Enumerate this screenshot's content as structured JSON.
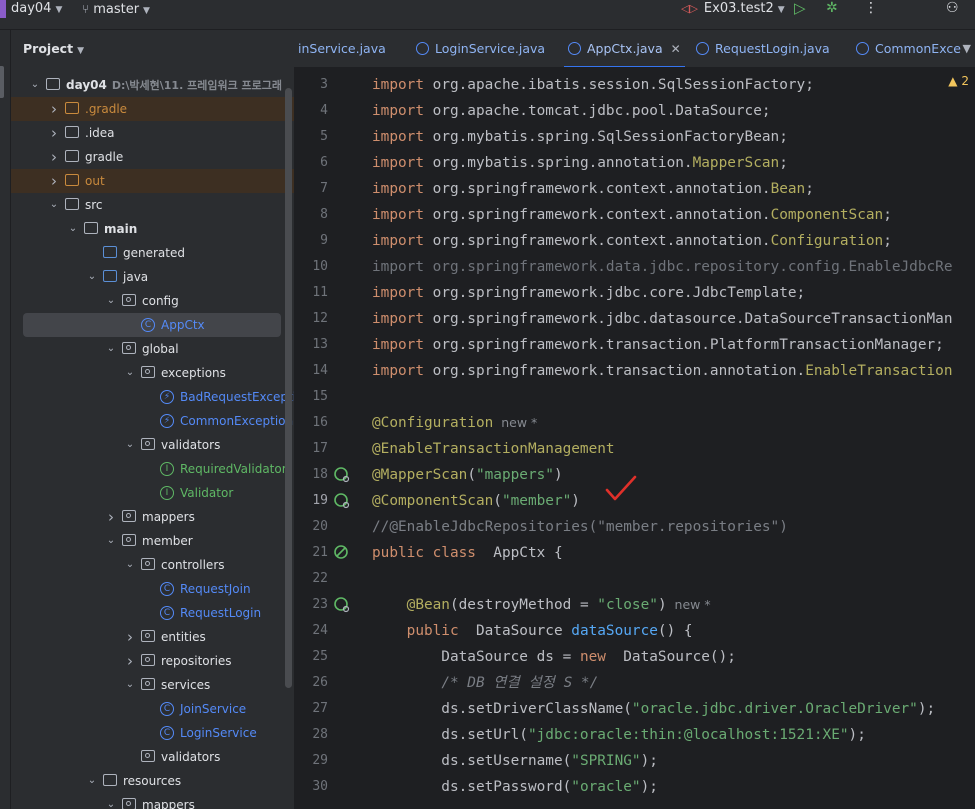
{
  "titlebar": {
    "project": "day04",
    "branch": "master",
    "run_config": "Ex03.test2"
  },
  "project_panel": {
    "title": "Project",
    "tree": [
      {
        "label": "day04",
        "path": "D:\\박세현\\11. 프레임워크 프로그래",
        "depth": 0,
        "kind": "module",
        "expanded": true
      },
      {
        "label": ".gradle",
        "depth": 1,
        "kind": "folder",
        "excluded": true,
        "expanded": false
      },
      {
        "label": ".idea",
        "depth": 1,
        "kind": "folder",
        "expanded": false
      },
      {
        "label": "gradle",
        "depth": 1,
        "kind": "folder",
        "expanded": false
      },
      {
        "label": "out",
        "depth": 1,
        "kind": "folder",
        "excluded": true,
        "expanded": false
      },
      {
        "label": "src",
        "depth": 1,
        "kind": "folder",
        "expanded": true
      },
      {
        "label": "main",
        "depth": 2,
        "kind": "module",
        "expanded": true
      },
      {
        "label": "generated",
        "depth": 3,
        "kind": "srcfolder",
        "leaf": true
      },
      {
        "label": "java",
        "depth": 3,
        "kind": "srcfolder",
        "expanded": true
      },
      {
        "label": "config",
        "depth": 4,
        "kind": "package",
        "expanded": true
      },
      {
        "label": "AppCtx",
        "depth": 5,
        "kind": "class",
        "selected": true
      },
      {
        "label": "global",
        "depth": 4,
        "kind": "package",
        "expanded": true
      },
      {
        "label": "exceptions",
        "depth": 5,
        "kind": "package",
        "expanded": true
      },
      {
        "label": "BadRequestException",
        "depth": 6,
        "kind": "exception"
      },
      {
        "label": "CommonException",
        "depth": 6,
        "kind": "exception"
      },
      {
        "label": "validators",
        "depth": 5,
        "kind": "package",
        "expanded": true
      },
      {
        "label": "RequiredValidator",
        "depth": 6,
        "kind": "interface"
      },
      {
        "label": "Validator",
        "depth": 6,
        "kind": "interface"
      },
      {
        "label": "mappers",
        "depth": 4,
        "kind": "package",
        "expanded": false
      },
      {
        "label": "member",
        "depth": 4,
        "kind": "package",
        "expanded": true
      },
      {
        "label": "controllers",
        "depth": 5,
        "kind": "package",
        "expanded": true
      },
      {
        "label": "RequestJoin",
        "depth": 6,
        "kind": "class"
      },
      {
        "label": "RequestLogin",
        "depth": 6,
        "kind": "class"
      },
      {
        "label": "entities",
        "depth": 5,
        "kind": "package",
        "expanded": false
      },
      {
        "label": "repositories",
        "depth": 5,
        "kind": "package",
        "expanded": false
      },
      {
        "label": "services",
        "depth": 5,
        "kind": "package",
        "expanded": true
      },
      {
        "label": "JoinService",
        "depth": 6,
        "kind": "class"
      },
      {
        "label": "LoginService",
        "depth": 6,
        "kind": "class"
      },
      {
        "label": "validators",
        "depth": 5,
        "kind": "package",
        "leaf": true
      },
      {
        "label": "resources",
        "depth": 3,
        "kind": "resfolder",
        "expanded": true
      },
      {
        "label": "mappers",
        "depth": 4,
        "kind": "package",
        "expanded": true
      }
    ]
  },
  "tabs": [
    {
      "label": "inService.java",
      "active": false
    },
    {
      "label": "LoginService.java",
      "active": false
    },
    {
      "label": "AppCtx.java",
      "active": true
    },
    {
      "label": "RequestLogin.java",
      "active": false
    },
    {
      "label": "CommonExce",
      "active": false
    }
  ],
  "editor": {
    "warnings": "2",
    "hint_new": "new *",
    "lines": [
      {
        "n": "3",
        "parts": [
          [
            "kw",
            "import"
          ],
          [
            "",
            "org.apache.ibatis.session.SqlSessionFactory;"
          ]
        ]
      },
      {
        "n": "4",
        "parts": [
          [
            "kw",
            "import"
          ],
          [
            "",
            "org.apache.tomcat.jdbc.pool.DataSource;"
          ]
        ]
      },
      {
        "n": "5",
        "parts": [
          [
            "kw",
            "import"
          ],
          [
            "",
            "org.mybatis.spring.SqlSessionFactoryBean;"
          ]
        ]
      },
      {
        "n": "6",
        "parts": [
          [
            "kw",
            "import"
          ],
          [
            "",
            "org.mybatis.spring.annotation."
          ],
          [
            "ann",
            "MapperScan"
          ],
          [
            "",
            ";"
          ]
        ]
      },
      {
        "n": "7",
        "parts": [
          [
            "kw",
            "import"
          ],
          [
            "",
            "org.springframework.context.annotation."
          ],
          [
            "ann",
            "Bean"
          ],
          [
            "",
            ";"
          ]
        ]
      },
      {
        "n": "8",
        "parts": [
          [
            "kw",
            "import"
          ],
          [
            "",
            "org.springframework.context.annotation."
          ],
          [
            "ann",
            "ComponentScan"
          ],
          [
            "",
            ";"
          ]
        ]
      },
      {
        "n": "9",
        "parts": [
          [
            "kw",
            "import"
          ],
          [
            "",
            "org.springframework.context.annotation."
          ],
          [
            "ann",
            "Configuration"
          ],
          [
            "",
            ";"
          ]
        ]
      },
      {
        "n": "10",
        "parts": [
          [
            "dim",
            "import org.springframework.data.jdbc.repository.config.EnableJdbcRe"
          ]
        ]
      },
      {
        "n": "11",
        "parts": [
          [
            "kw",
            "import"
          ],
          [
            "",
            "org.springframework.jdbc.core.JdbcTemplate;"
          ]
        ]
      },
      {
        "n": "12",
        "parts": [
          [
            "kw",
            "import"
          ],
          [
            "",
            "org.springframework.jdbc.datasource.DataSourceTransactionMan"
          ]
        ]
      },
      {
        "n": "13",
        "parts": [
          [
            "kw",
            "import"
          ],
          [
            "",
            "org.springframework.transaction.PlatformTransactionManager;"
          ]
        ]
      },
      {
        "n": "14",
        "parts": [
          [
            "kw",
            "import"
          ],
          [
            "",
            "org.springframework.transaction.annotation."
          ],
          [
            "ann",
            "EnableTransaction"
          ]
        ]
      },
      {
        "n": "15",
        "parts": []
      },
      {
        "n": "16",
        "parts": [
          [
            "ann",
            "@Configuration"
          ],
          [
            "hint",
            "  new *"
          ]
        ]
      },
      {
        "n": "17",
        "parts": [
          [
            "ann",
            "@EnableTransactionManagement"
          ]
        ]
      },
      {
        "n": "18",
        "parts": [
          [
            "ann",
            "@MapperScan"
          ],
          [
            "",
            "("
          ],
          [
            "str",
            "\"mappers\""
          ],
          [
            "",
            ")"
          ]
        ]
      },
      {
        "n": "19",
        "parts": [
          [
            "ann",
            "@ComponentScan"
          ],
          [
            "",
            "("
          ],
          [
            "str",
            "\"member\""
          ],
          [
            "",
            ")"
          ]
        ]
      },
      {
        "n": "20",
        "parts": [
          [
            "cmt",
            "//@EnableJdbcRepositories(\"member.repositories\")"
          ]
        ]
      },
      {
        "n": "21",
        "parts": [
          [
            "kw",
            "public class"
          ],
          [
            "",
            " AppCtx {"
          ]
        ]
      },
      {
        "n": "22",
        "parts": []
      },
      {
        "n": "23",
        "parts": [
          [
            "",
            "    "
          ],
          [
            "ann",
            "@Bean"
          ],
          [
            "",
            "(destroyMethod = "
          ],
          [
            "str",
            "\"close\""
          ],
          [
            "",
            ")"
          ],
          [
            "hint",
            "  new *"
          ]
        ]
      },
      {
        "n": "24",
        "parts": [
          [
            "",
            "    "
          ],
          [
            "kw",
            "public"
          ],
          [
            "",
            " DataSource "
          ],
          [
            "fn",
            "dataSource"
          ],
          [
            "",
            "() {"
          ]
        ]
      },
      {
        "n": "25",
        "parts": [
          [
            "",
            "        DataSource ds = "
          ],
          [
            "kw",
            "new"
          ],
          [
            "",
            " DataSource();"
          ]
        ]
      },
      {
        "n": "26",
        "parts": [
          [
            "",
            "        "
          ],
          [
            "cmt-i",
            "/* DB 연결 설정 S */"
          ]
        ]
      },
      {
        "n": "27",
        "parts": [
          [
            "",
            "        ds.setDriverClassName("
          ],
          [
            "str",
            "\"oracle.jdbc.driver.OracleDriver\""
          ],
          [
            "",
            ");"
          ]
        ]
      },
      {
        "n": "28",
        "parts": [
          [
            "",
            "        ds.setUrl("
          ],
          [
            "str",
            "\"jdbc:oracle:thin:@localhost:1521:XE\""
          ],
          [
            "",
            ");"
          ]
        ]
      },
      {
        "n": "29",
        "parts": [
          [
            "",
            "        ds.setUsername("
          ],
          [
            "str",
            "\"SPRING\""
          ],
          [
            "",
            ");"
          ]
        ]
      },
      {
        "n": "30",
        "parts": [
          [
            "",
            "        ds.setPassword("
          ],
          [
            "str",
            "\"oracle\""
          ],
          [
            "",
            ");"
          ]
        ]
      }
    ]
  },
  "colors": {
    "accent": "#3574f0",
    "keyword": "#cf8e6d",
    "annotation": "#b3ae60",
    "string": "#6aab73",
    "method": "#56a8f5",
    "checkmark": "#e0302a"
  }
}
